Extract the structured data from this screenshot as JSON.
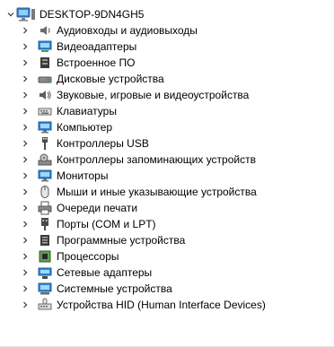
{
  "root": {
    "label": "DESKTOP-9DN4GH5",
    "icon": "computer-root-icon",
    "expanded": true
  },
  "items": [
    {
      "label": "Аудиовходы и аудиовыходы",
      "icon": "speaker-icon"
    },
    {
      "label": "Видеоадаптеры",
      "icon": "display-adapter-icon"
    },
    {
      "label": "Встроенное ПО",
      "icon": "firmware-icon"
    },
    {
      "label": "Дисковые устройства",
      "icon": "disk-drive-icon"
    },
    {
      "label": "Звуковые, игровые и видеоустройства",
      "icon": "sound-icon"
    },
    {
      "label": "Клавиатуры",
      "icon": "keyboard-icon"
    },
    {
      "label": "Компьютер",
      "icon": "computer-icon"
    },
    {
      "label": "Контроллеры USB",
      "icon": "usb-icon"
    },
    {
      "label": "Контроллеры запоминающих устройств",
      "icon": "storage-controller-icon"
    },
    {
      "label": "Мониторы",
      "icon": "monitor-icon"
    },
    {
      "label": "Мыши и иные указывающие устройства",
      "icon": "mouse-icon"
    },
    {
      "label": "Очереди печати",
      "icon": "printer-icon"
    },
    {
      "label": "Порты (COM и LPT)",
      "icon": "port-icon"
    },
    {
      "label": "Программные устройства",
      "icon": "software-device-icon"
    },
    {
      "label": "Процессоры",
      "icon": "processor-icon"
    },
    {
      "label": "Сетевые адаптеры",
      "icon": "network-adapter-icon"
    },
    {
      "label": "Системные устройства",
      "icon": "system-device-icon"
    },
    {
      "label": "Устройства HID (Human Interface Devices)",
      "icon": "hid-icon"
    }
  ],
  "colors": {
    "toggle": "#333333",
    "accent": "#1e6fc4"
  }
}
